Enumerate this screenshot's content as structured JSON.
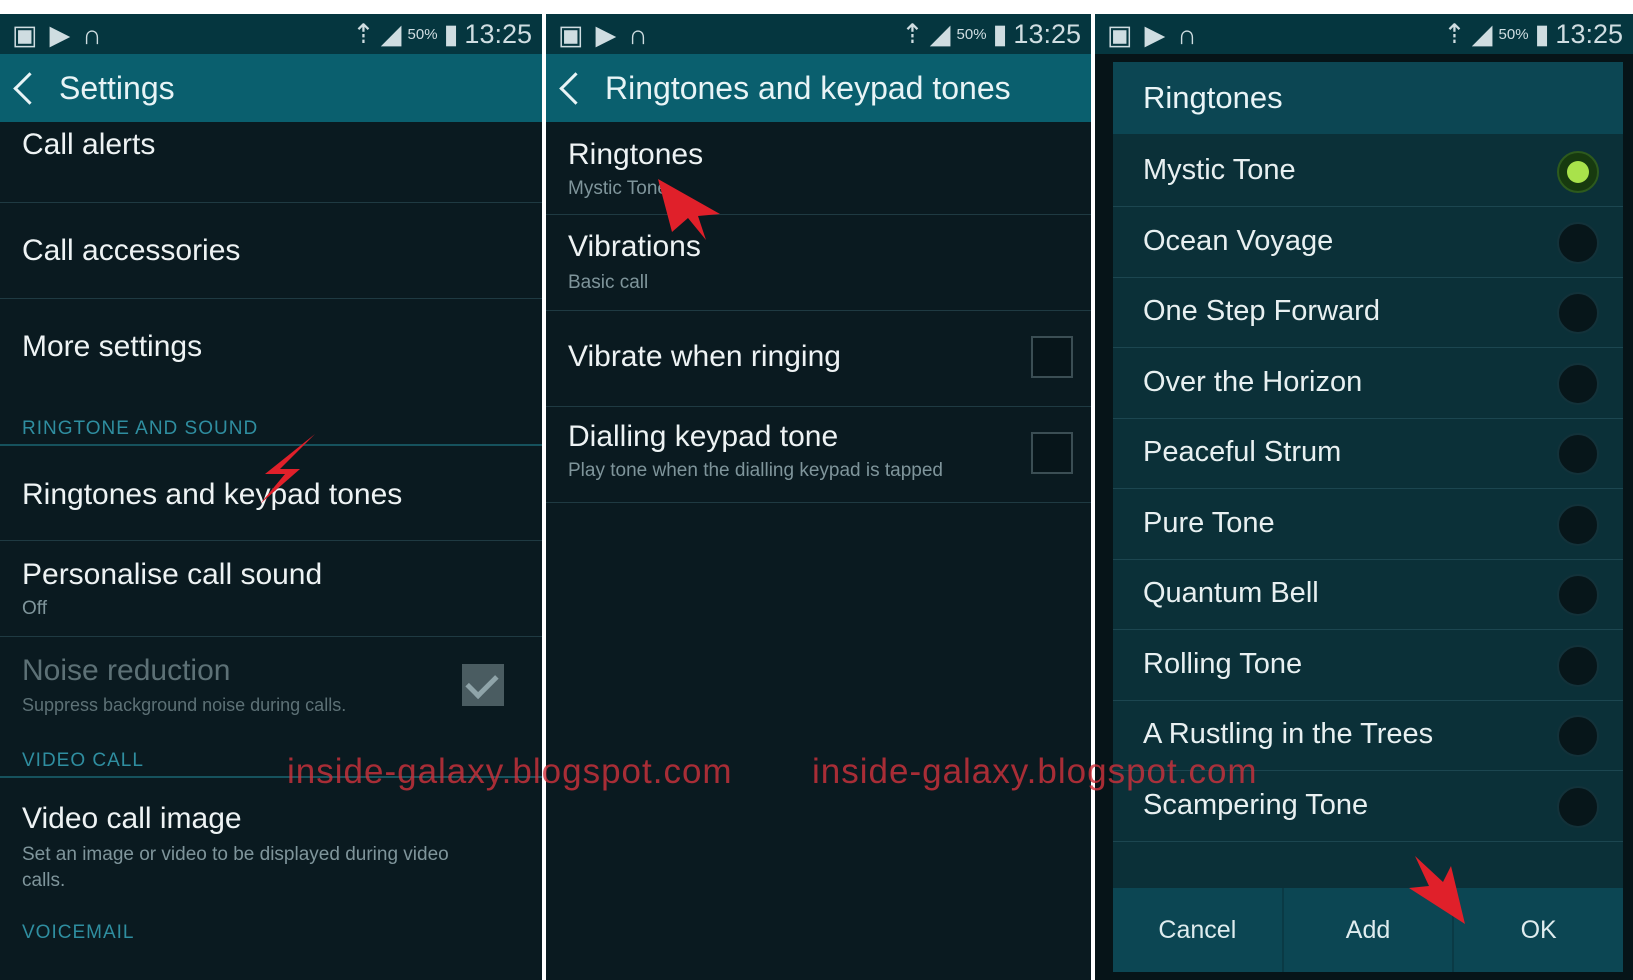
{
  "status_bar": {
    "time": "13:25",
    "battery": "50%"
  },
  "panel1": {
    "title": "Settings",
    "items": [
      {
        "title": "Call alerts"
      },
      {
        "title": "Call accessories"
      },
      {
        "title": "More settings"
      }
    ],
    "section_ringtone": "RINGTONE AND SOUND",
    "ringtones_item": "Ringtones and keypad tones",
    "personalise": {
      "title": "Personalise call sound",
      "sub": "Off"
    },
    "noise": {
      "title": "Noise reduction",
      "sub": "Suppress background noise during calls.",
      "checked": true
    },
    "section_video": "VIDEO CALL",
    "video_image": {
      "title": "Video call image",
      "sub": "Set an image or video to be displayed during video calls."
    },
    "section_voicemail": "VOICEMAIL"
  },
  "panel2": {
    "title": "Ringtones and keypad tones",
    "ringtones": {
      "title": "Ringtones",
      "sub": "Mystic Tone"
    },
    "vibrations": {
      "title": "Vibrations",
      "sub": "Basic call"
    },
    "vibrate_ringing": {
      "title": "Vibrate when ringing",
      "checked": false
    },
    "dialling": {
      "title": "Dialling keypad tone",
      "sub": "Play tone when the dialling keypad is tapped",
      "checked": false
    }
  },
  "panel3": {
    "dialog_title": "Ringtones",
    "options": [
      {
        "label": "Mystic Tone",
        "selected": true
      },
      {
        "label": "Ocean Voyage",
        "selected": false
      },
      {
        "label": "One Step Forward",
        "selected": false
      },
      {
        "label": "Over the Horizon",
        "selected": false
      },
      {
        "label": "Peaceful Strum",
        "selected": false
      },
      {
        "label": "Pure Tone",
        "selected": false
      },
      {
        "label": "Quantum Bell",
        "selected": false
      },
      {
        "label": "Rolling Tone",
        "selected": false
      },
      {
        "label": "A Rustling in the Trees",
        "selected": false
      },
      {
        "label": "Scampering Tone",
        "selected": false
      }
    ],
    "buttons": {
      "cancel": "Cancel",
      "add": "Add",
      "ok": "OK"
    }
  },
  "watermark": "inside-galaxy.blogspot.com",
  "colors": {
    "action_bar": "#0a5f6e",
    "background": "#0a1a20",
    "radio_selected": "#a9e24b",
    "arrow": "#e0202a"
  }
}
